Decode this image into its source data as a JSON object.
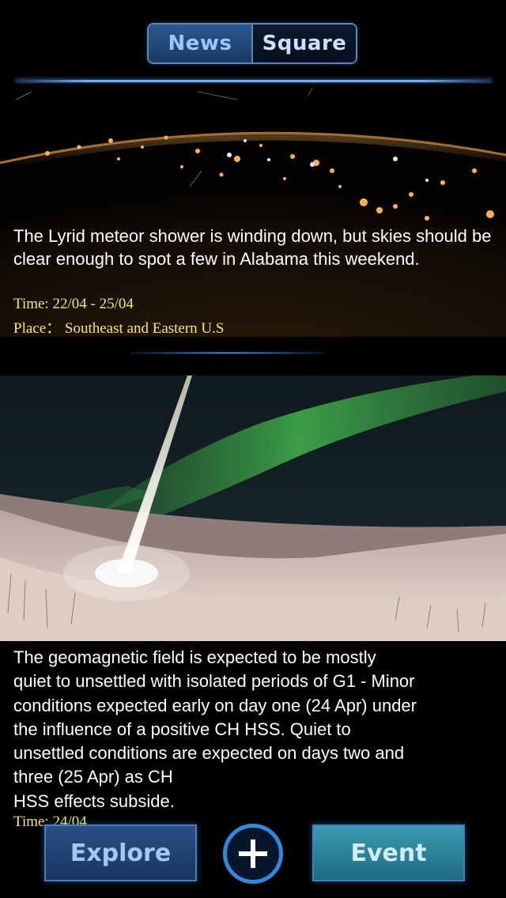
{
  "segmented": {
    "news": "News",
    "square": "Square"
  },
  "card1": {
    "text": "The Lyrid meteor shower is winding down, but skies should be clear enough to spot a few in Alabama this weekend.",
    "time": "Time: 22/04 -  25/04",
    "place": "Place： Southeast  and Eastern U.S"
  },
  "card2": {
    "line1": "The geomagnetic field is expected to be mostly",
    "line2": "quiet to unsettled with isolated periods of G1 - Minor",
    "line3": "conditions expected early on day one (24 Apr) under",
    "line4": "the influence of a positive CH HSS. Quiet to",
    "line5": "unsettled conditions are expected on days two and",
    "line6": "three (25 Apr) as CH",
    "line7": "HSS effects subside.",
    "time": "Time: 24/04"
  },
  "toolbar": {
    "explore": "Explore",
    "event": "Event"
  },
  "icons": {
    "add": "plus-icon"
  },
  "colors": {
    "accent": "#2f8be0",
    "meta": "#f6e86a"
  }
}
